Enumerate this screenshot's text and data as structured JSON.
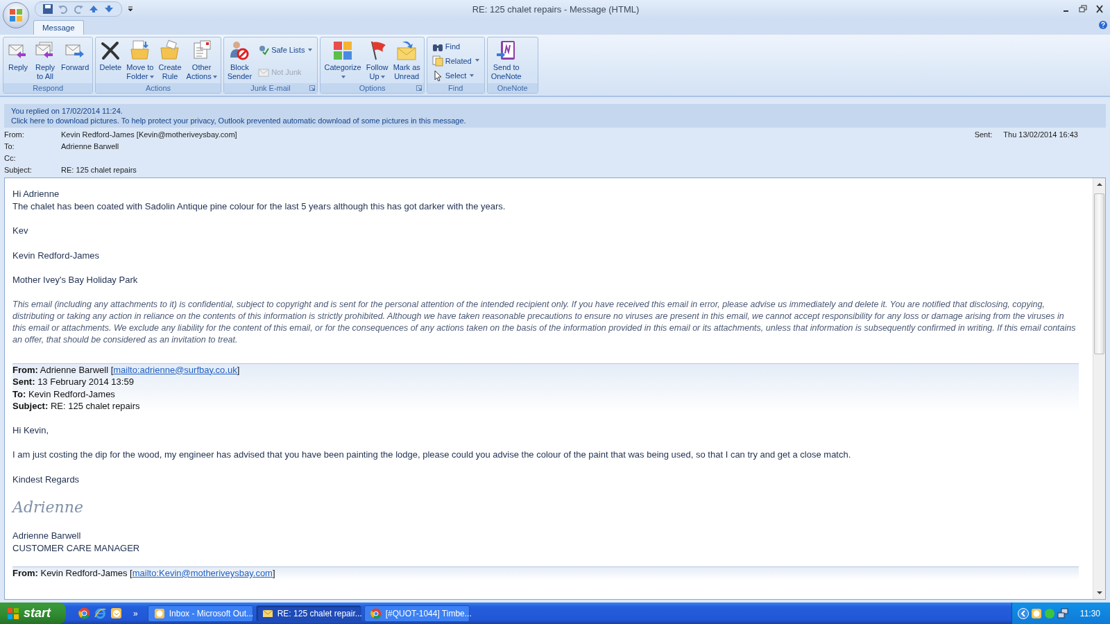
{
  "window": {
    "title": "RE: 125 chalet repairs - Message (HTML)"
  },
  "tabs": [
    {
      "label": "Message",
      "selected": true
    }
  ],
  "ribbon": {
    "groups": [
      {
        "label": "Respond",
        "launcher": false,
        "items": [
          {
            "kind": "large",
            "lines": [
              "Reply"
            ],
            "caret": false
          },
          {
            "kind": "large",
            "lines": [
              "Reply",
              "to All"
            ],
            "caret": false
          },
          {
            "kind": "large",
            "lines": [
              "Forward"
            ],
            "caret": false
          }
        ]
      },
      {
        "label": "Actions",
        "launcher": false,
        "items": [
          {
            "kind": "large",
            "lines": [
              "Delete"
            ],
            "caret": false
          },
          {
            "kind": "large",
            "lines": [
              "Move to",
              "Folder"
            ],
            "caret": true
          },
          {
            "kind": "large",
            "lines": [
              "Create",
              "Rule"
            ],
            "caret": false
          },
          {
            "kind": "large",
            "lines": [
              "Other",
              "Actions"
            ],
            "caret": true
          }
        ]
      },
      {
        "label": "Junk E-mail",
        "launcher": true,
        "items": [
          {
            "kind": "large",
            "lines": [
              "Block",
              "Sender"
            ],
            "caret": false
          },
          {
            "kind": "small",
            "label": "Safe Lists",
            "caret": true,
            "disabled": false
          },
          {
            "kind": "small",
            "label": "Not Junk",
            "caret": false,
            "disabled": true
          }
        ]
      },
      {
        "label": "Options",
        "launcher": true,
        "items": [
          {
            "kind": "large",
            "lines": [
              "Categorize"
            ],
            "caret": true
          },
          {
            "kind": "large",
            "lines": [
              "Follow",
              "Up"
            ],
            "caret": true
          },
          {
            "kind": "large",
            "lines": [
              "Mark as",
              "Unread"
            ],
            "caret": false
          }
        ]
      },
      {
        "label": "Find",
        "launcher": false,
        "items": [
          {
            "kind": "small",
            "label": "Find",
            "caret": false,
            "disabled": false
          },
          {
            "kind": "small",
            "label": "Related",
            "caret": true,
            "disabled": false
          },
          {
            "kind": "small",
            "label": "Select",
            "caret": true,
            "disabled": false
          }
        ]
      },
      {
        "label": "OneNote",
        "launcher": false,
        "items": [
          {
            "kind": "large",
            "lines": [
              "Send to",
              "OneNote"
            ],
            "caret": false
          }
        ]
      }
    ]
  },
  "infobar": {
    "lines": [
      "You replied on 17/02/2014 11:24.",
      "Click here to download pictures. To help protect your privacy, Outlook prevented automatic download of some pictures in this message."
    ]
  },
  "header": {
    "fields": [
      {
        "label": "From:",
        "value": "Kevin Redford-James [Kevin@motheriveysbay.com]"
      },
      {
        "label": "To:",
        "value": "Adrienne Barwell"
      },
      {
        "label": "Cc:"
      },
      {
        "label": "Subject:",
        "value": "RE: 125 chalet repairs"
      }
    ],
    "sent": {
      "label": "Sent:",
      "value": "Thu 13/02/2014 16:43"
    }
  },
  "message": {
    "blocks": [
      {
        "kind": "para",
        "lines": [
          "Hi Adrienne",
          "The chalet has been coated with Sadolin Antique pine colour for the last 5 years although this has got darker with the years."
        ]
      },
      {
        "kind": "para",
        "lines": [
          "Kev"
        ]
      },
      {
        "kind": "para",
        "lines": [
          "Kevin Redford-James"
        ]
      },
      {
        "kind": "para",
        "lines": [
          "Mother Ivey's Bay Holiday Park"
        ]
      },
      {
        "kind": "disclaimer",
        "text": "This email (including any attachments to it) is confidential, subject to copyright and is sent for the personal attention of the intended recipient only. If you have received this email in error, please advise us immediately and delete it. You are notified that disclosing, copying, distributing or taking any action in reliance on the contents of this information is strictly prohibited. Although we have taken reasonable precautions to ensure no viruses are present in this email, we cannot accept responsibility for any loss or damage arising from the viruses in this email or attachments. We exclude any liability for the content of this email, or for the consequences of any actions taken on the basis of the information provided in this email or its attachments, unless that information is subsequently confirmed in writing. If this email contains an offer, that should be considered as an invitation to treat."
      },
      {
        "kind": "quote-header",
        "fields": [
          {
            "label": "From:",
            "value": "Adrienne Barwell [",
            "link": "mailto:adrienne@surfbay.co.uk",
            "tail": "]"
          },
          {
            "label": "Sent:",
            "value": "13 February 2014 13:59"
          },
          {
            "label": "To:",
            "value": "Kevin Redford-James"
          },
          {
            "label": "Subject:",
            "value": "RE: 125 chalet repairs"
          }
        ]
      },
      {
        "kind": "para",
        "lines": [
          "Hi Kevin,"
        ]
      },
      {
        "kind": "para",
        "lines": [
          "I am just costing the dip for the wood, my engineer has advised that you have been painting the lodge, please could you advise the colour of the paint that was being used, so that I can try and get a close match."
        ]
      },
      {
        "kind": "para",
        "lines": [
          "Kindest Regards"
        ]
      },
      {
        "kind": "signature",
        "text": "Adrienne"
      },
      {
        "kind": "para",
        "lines": [
          "Adrienne Barwell",
          "CUSTOMER CARE MANAGER"
        ]
      },
      {
        "kind": "quote-header",
        "fields": [
          {
            "label": "From:",
            "value": "Kevin Redford-James [",
            "link": "mailto:Kevin@motheriveysbay.com",
            "tail": "]"
          }
        ]
      }
    ]
  },
  "taskbar": {
    "start": "start",
    "overflow": "»",
    "buttons": [
      {
        "label": "Inbox - Microsoft Out...",
        "selected": false
      },
      {
        "label": "RE: 125 chalet repair...",
        "selected": true
      },
      {
        "label": "[#QUOT-1044] Timbe...",
        "selected": false
      }
    ],
    "clock": "11:30"
  }
}
